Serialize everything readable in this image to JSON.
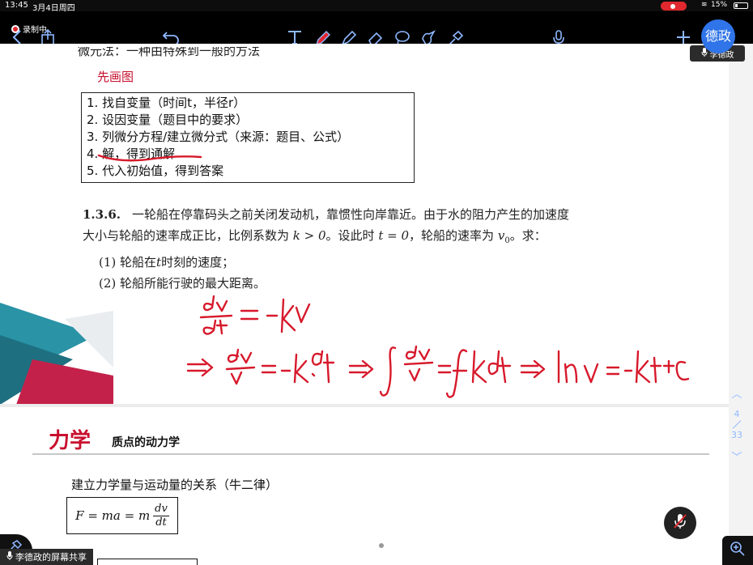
{
  "status_bar": {
    "time": "13:45",
    "date": "3月4日周四",
    "battery": "15%"
  },
  "toolbar": {
    "recording_label": "录制中"
  },
  "presenter": {
    "avatar_text": "德政",
    "name": "李德政"
  },
  "share": {
    "label": "李德政的屏幕共享"
  },
  "page1": {
    "top_line": "微元法：一种由特殊到一般的方法",
    "red_note": "先画图",
    "steps": [
      "1.  找自变量（时间t，半径r）",
      "2.  设因变量（题目中的要求）",
      "3.  列微分方程/建立微分式（来源：题目、公式）",
      "4.  解，得到通解",
      "5.  代入初始值，得到答案"
    ],
    "problem": {
      "number": "1.3.6.",
      "line1": "一轮船在停靠码头之前关闭发动机，靠惯性向岸靠近。由于水的阻力产生的加速度",
      "line2_a": "大小与轮船的速率成正比，比例系数为",
      "k_expr": "k > 0",
      "line2_b": "。设此时",
      "t_expr": "t = 0",
      "line2_c": "，轮船的速率为",
      "v0": "v",
      "v0_sub": "0",
      "line2_d": "。求：",
      "q1_a": "(1) 轮船在",
      "q1_t": "t",
      "q1_b": "时刻的速度；",
      "q2": "(2) 轮船所能行驶的最大距离。"
    },
    "handwriting": {
      "eq1": "dv/dt = -kv",
      "eq2": "=> dv/v = -k·dt => ∫dv/v = ∫-kdt => ln v = -kt+C"
    }
  },
  "page2": {
    "section_title": "力学",
    "section_subtitle": "质点的动力学",
    "text": "建立力学量与运动量的关系（牛二律）",
    "formula_left": "F = ma = m",
    "formula_num": "dv",
    "formula_den": "dt"
  },
  "pager": {
    "current": "4",
    "total": "33"
  },
  "colors": {
    "accent": "#2f74e8",
    "ink_red": "#d7192b",
    "title_red": "#c8102e"
  }
}
